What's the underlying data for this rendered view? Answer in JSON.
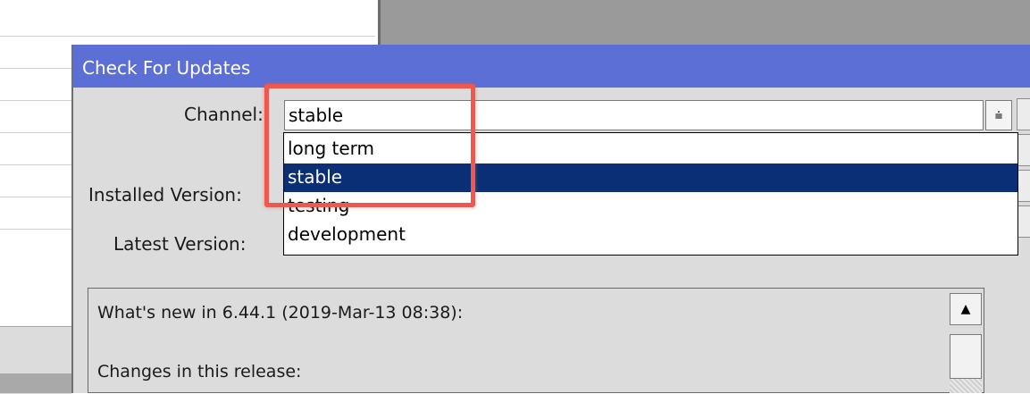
{
  "dialog": {
    "title": "Check For Updates",
    "channel_label": "Channel:",
    "channel_value": "stable",
    "installed_label": "Installed Version:",
    "latest_label": "Latest Version:"
  },
  "dropdown": {
    "options": [
      "long term",
      "stable",
      "testing",
      "development"
    ],
    "selected": "stable"
  },
  "notes": {
    "line1": "What's new in 6.44.1 (2019-Mar-13 08:38):",
    "line2": "Changes in this release:"
  },
  "colors": {
    "title_bar": "#5b6fd6",
    "selection": "#0a2f74",
    "highlight": "#f0584f"
  },
  "icons": {
    "dropdown": "dropdown-arrow-icon",
    "scroll_up": "scroll-up-arrow-icon"
  }
}
